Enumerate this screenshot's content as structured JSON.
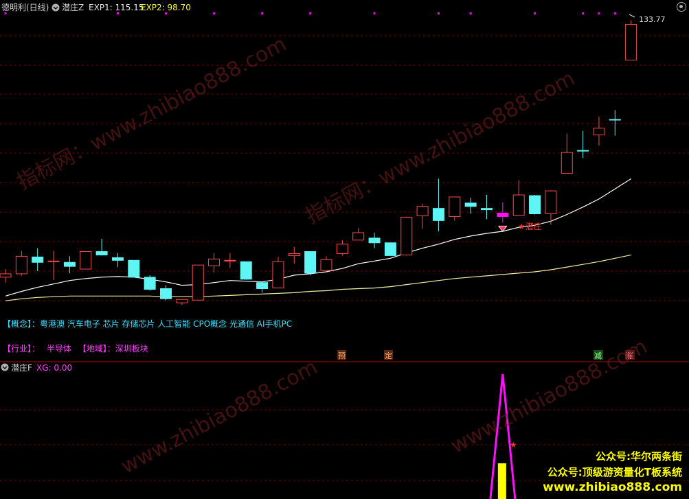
{
  "header": {
    "stock_label": "德明利(日线)",
    "indicator_name": "潜庄Z",
    "exp1_label": "EXP1: 115.15",
    "exp2_label": "EXP2: 98.70"
  },
  "sub_header": {
    "indicator_name": "潜庄F",
    "xg_label": "XG: 0.00"
  },
  "info": {
    "concept_tag": "【概念】",
    "concept_sep": "：",
    "concepts": "粤港澳 汽车电子 芯片 存储芯片 人工智能 CPO概念 光通信 AI手机PC",
    "industry_tag": "【行业】",
    "industry_sep": "：",
    "industry": "半导体",
    "region_tag": "【地域】",
    "region_sep": "：",
    "region": "深圳板块"
  },
  "signals": {
    "star_label": "★潜庄",
    "price_marker": "133.77",
    "yu": "预",
    "ding": "定",
    "jian": "减",
    "zhang": "涨"
  },
  "watermarks": [
    "指标网：www.zhibiao888.com",
    "指标网：www.zhibiao888.com",
    "www.zhibiao888.com",
    "www.zhibiao888.com"
  ],
  "promo": {
    "line1": "公众号:华尔两条街",
    "line2": "公众号:顶级游资量化T板系统",
    "line3": "www.zhibiao888.com"
  },
  "colors": {
    "up": "#ff4a4a",
    "down": "#5ff5f5",
    "signal_bar": "#ff10ff",
    "ma_short": "#ffffff",
    "ma_long": "#f0f0a0",
    "grid": "#7a0000",
    "dots": "#ff00ff"
  },
  "chart_data": {
    "type": "candlestick",
    "y_unit": "price",
    "ylim": [
      91,
      136
    ],
    "last_high": 133.77,
    "candles": [
      {
        "o": 95.7,
        "h": 96.9,
        "c": 96.2,
        "l": 94.9
      },
      {
        "o": 96.2,
        "h": 99.6,
        "c": 98.8,
        "l": 95.9
      },
      {
        "o": 98.7,
        "h": 100.0,
        "c": 97.9,
        "l": 96.6
      },
      {
        "o": 98.1,
        "h": 99.6,
        "c": 98.1,
        "l": 95.3
      },
      {
        "o": 97.9,
        "h": 98.8,
        "c": 97.3,
        "l": 96.3
      },
      {
        "o": 96.9,
        "h": 99.5,
        "c": 99.5,
        "l": 96.9
      },
      {
        "o": 99.5,
        "h": 101.4,
        "c": 99.0,
        "l": 98.9
      },
      {
        "o": 98.6,
        "h": 99.3,
        "c": 98.2,
        "l": 97.2
      },
      {
        "o": 98.2,
        "h": 98.2,
        "c": 95.7,
        "l": 95.7
      },
      {
        "o": 95.7,
        "h": 96.0,
        "c": 93.9,
        "l": 93.7
      },
      {
        "o": 94.0,
        "h": 94.5,
        "c": 92.5,
        "l": 92.3
      },
      {
        "o": 91.9,
        "h": 92.4,
        "c": 92.4,
        "l": 91.6
      },
      {
        "o": 92.3,
        "h": 97.5,
        "c": 97.5,
        "l": 92.3
      },
      {
        "o": 97.4,
        "h": 99.3,
        "c": 98.4,
        "l": 96.4
      },
      {
        "o": 98.2,
        "h": 99.3,
        "c": 98.2,
        "l": 97.1
      },
      {
        "o": 98.0,
        "h": 98.0,
        "c": 95.4,
        "l": 95.3
      },
      {
        "o": 94.9,
        "h": 94.9,
        "c": 94.0,
        "l": 93.4
      },
      {
        "o": 94.1,
        "h": 98.7,
        "c": 98.0,
        "l": 94.1
      },
      {
        "o": 98.9,
        "h": 100.2,
        "c": 99.2,
        "l": 97.7
      },
      {
        "o": 99.5,
        "h": 99.5,
        "c": 96.3,
        "l": 96.0
      },
      {
        "o": 96.7,
        "h": 98.8,
        "c": 98.3,
        "l": 96.9
      },
      {
        "o": 99.2,
        "h": 101.2,
        "c": 100.6,
        "l": 98.9
      },
      {
        "o": 101.2,
        "h": 103.0,
        "c": 102.3,
        "l": 101.6
      },
      {
        "o": 101.5,
        "h": 102.3,
        "c": 100.8,
        "l": 100.0
      },
      {
        "o": 100.8,
        "h": 100.8,
        "c": 98.9,
        "l": 98.9
      },
      {
        "o": 99.0,
        "h": 104.7,
        "c": 104.6,
        "l": 98.9
      },
      {
        "o": 104.8,
        "h": 106.6,
        "c": 106.2,
        "l": 102.9
      },
      {
        "o": 105.9,
        "h": 110.3,
        "c": 104.1,
        "l": 102.5
      },
      {
        "o": 104.7,
        "h": 106.6,
        "c": 107.6,
        "l": 104.1
      },
      {
        "o": 106.7,
        "h": 107.5,
        "c": 106.2,
        "l": 105.1
      },
      {
        "o": 105.9,
        "h": 107.9,
        "c": 105.7,
        "l": 104.3
      },
      {
        "o": 105.2,
        "h": 106.8,
        "c": 104.7,
        "l": 103.8
      },
      {
        "o": 104.9,
        "h": 110.1,
        "c": 107.9,
        "l": 104.9
      },
      {
        "o": 107.8,
        "h": 107.9,
        "c": 105.1,
        "l": 105.0
      },
      {
        "o": 105.1,
        "h": 108.6,
        "c": 108.5,
        "l": 103.5
      },
      {
        "o": 111.1,
        "h": 117.0,
        "c": 114.2,
        "l": 111.1
      },
      {
        "o": 114.5,
        "h": 117.4,
        "c": 114.4,
        "l": 113.4
      },
      {
        "o": 116.8,
        "h": 119.5,
        "c": 117.8,
        "l": 115.2
      },
      {
        "o": 119.1,
        "h": 120.5,
        "c": 119.0,
        "l": 116.7
      },
      {
        "o": 127.9,
        "h": 133.77,
        "c": 133.2,
        "l": 127.9
      }
    ],
    "x_slots": [
      0,
      1,
      2,
      3,
      4,
      5,
      6,
      7,
      8,
      9,
      10,
      11,
      12,
      13,
      14,
      15,
      16,
      17,
      18,
      19,
      20,
      21,
      22,
      23,
      24,
      25,
      26,
      27,
      28,
      29,
      30,
      31,
      32,
      33,
      34,
      35,
      36,
      37,
      38,
      39
    ],
    "ma_short": [
      92.9,
      93.6,
      94.2,
      94.7,
      95.2,
      95.5,
      95.7,
      95.8,
      95.7,
      95.4,
      95.0,
      94.5,
      94.6,
      94.9,
      95.2,
      95.1,
      95.0,
      95.4,
      96.0,
      96.2,
      96.5,
      97.0,
      97.7,
      98.1,
      98.5,
      99.3,
      100.0,
      100.6,
      101.3,
      101.8,
      102.2,
      102.5,
      103.1,
      103.4,
      104.0,
      105.0,
      106.1,
      107.3,
      108.8,
      110.3
    ],
    "ma_long": [
      92.2,
      92.5,
      92.7,
      92.8,
      92.9,
      92.9,
      92.9,
      92.9,
      92.9,
      92.9,
      92.8,
      92.8,
      92.8,
      92.9,
      93.0,
      93.1,
      93.2,
      93.3,
      93.4,
      93.6,
      93.7,
      93.9,
      94.0,
      94.1,
      94.3,
      94.6,
      94.9,
      95.2,
      95.5,
      95.7,
      95.9,
      96.1,
      96.3,
      96.5,
      96.8,
      97.2,
      97.6,
      98.0,
      98.5,
      99.0
    ],
    "top_dots": [
      0,
      7,
      10,
      13,
      16,
      19,
      23,
      27,
      29,
      33,
      36,
      37,
      38
    ],
    "sub_chart": {
      "type": "signal",
      "ylim": [
        0,
        1
      ],
      "spike_slot": 31,
      "spike_value": 1
    }
  }
}
